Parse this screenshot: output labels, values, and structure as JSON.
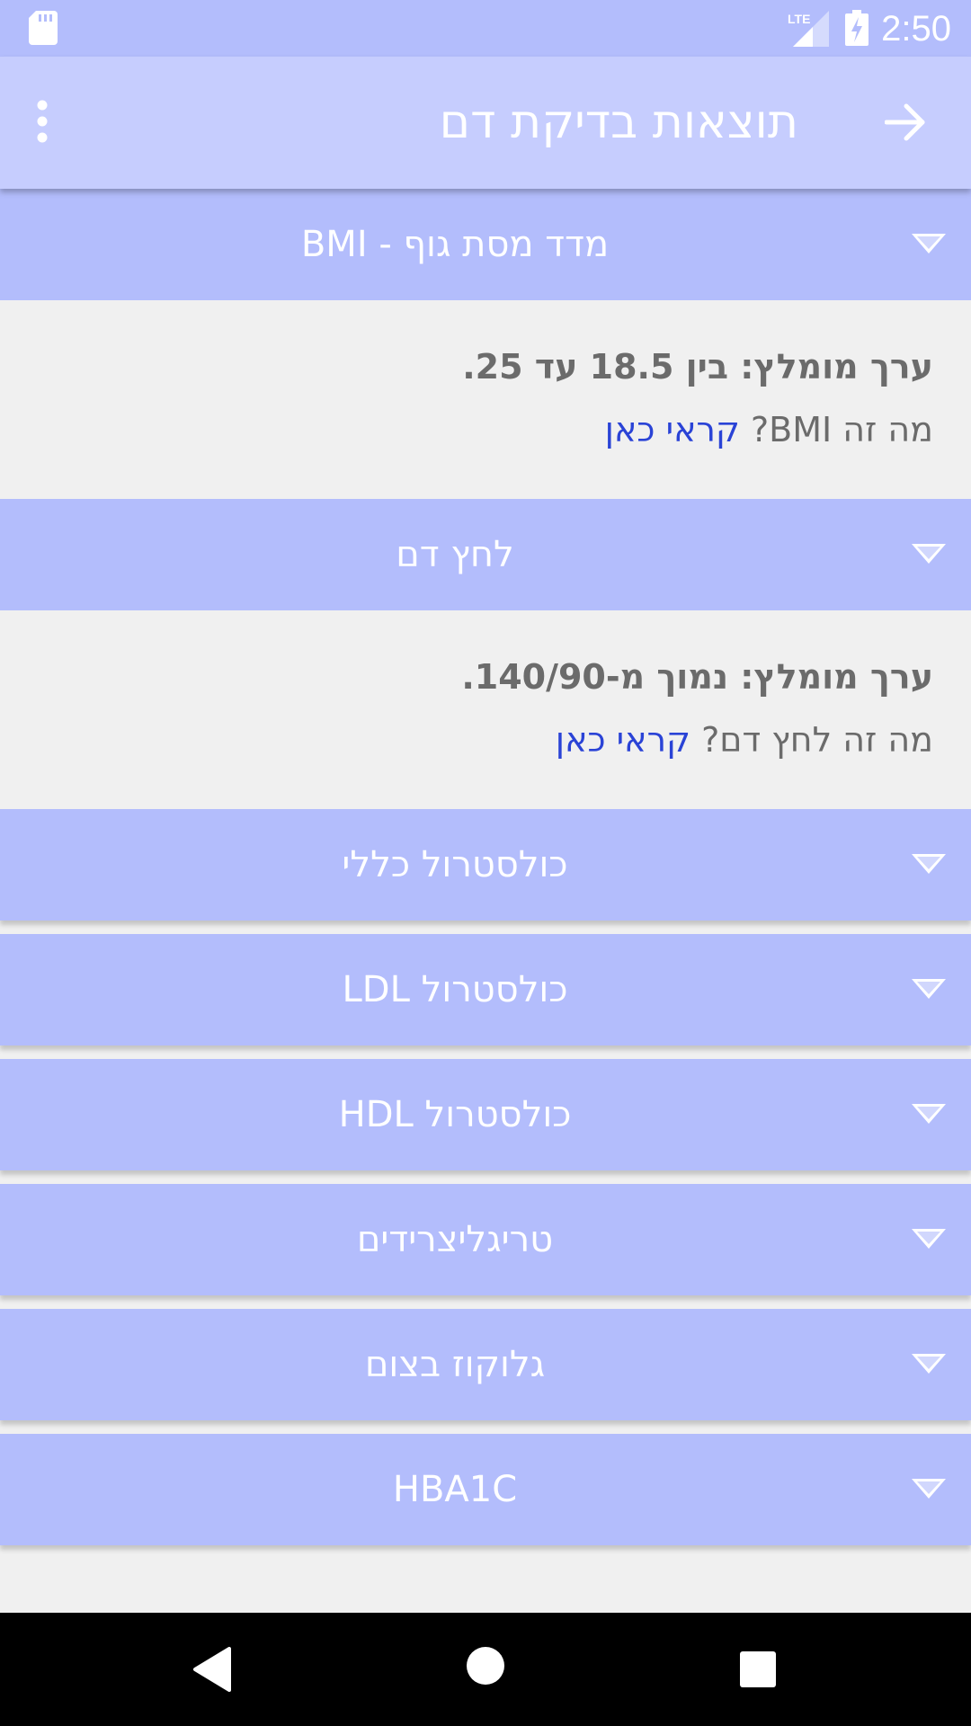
{
  "status_bar": {
    "time": "2:50",
    "network": "LTE",
    "icons": [
      "sd-card-icon",
      "signal-icon",
      "battery-charging-icon"
    ]
  },
  "app_bar": {
    "title": "תוצאות בדיקת דם",
    "back_icon": "arrow-forward-icon",
    "menu_icon": "more-vert-icon"
  },
  "sections": [
    {
      "title": "מדד מסת גוף - BMI",
      "expanded": true,
      "recommended": "ערך מומלץ: בין 18.5 עד 25.",
      "question": "מה זה BMI?",
      "link": "קראי כאן"
    },
    {
      "title": "לחץ דם",
      "expanded": true,
      "recommended": "ערך מומלץ: נמוך מ-140/90.",
      "question": "מה זה לחץ דם?",
      "link": "קראי כאן"
    },
    {
      "title": "כולסטרול כללי",
      "expanded": false
    },
    {
      "title": "כולסטרול LDL",
      "expanded": false
    },
    {
      "title": "כולסטרול HDL",
      "expanded": false
    },
    {
      "title": "טריגליצרידים",
      "expanded": false
    },
    {
      "title": "גלוקוז בצום",
      "expanded": false
    },
    {
      "title": "HBA1C",
      "expanded": false
    }
  ],
  "colors": {
    "status_bar": "#b3bdfc",
    "app_bar": "#c6cdfe",
    "section_header": "#b3bdfc",
    "background": "#f0f0f0",
    "link": "#2a43d6",
    "body_text": "#6b6b6b"
  },
  "nav_bar": {
    "icons": [
      "back-triangle-icon",
      "home-circle-icon",
      "recents-square-icon"
    ]
  }
}
